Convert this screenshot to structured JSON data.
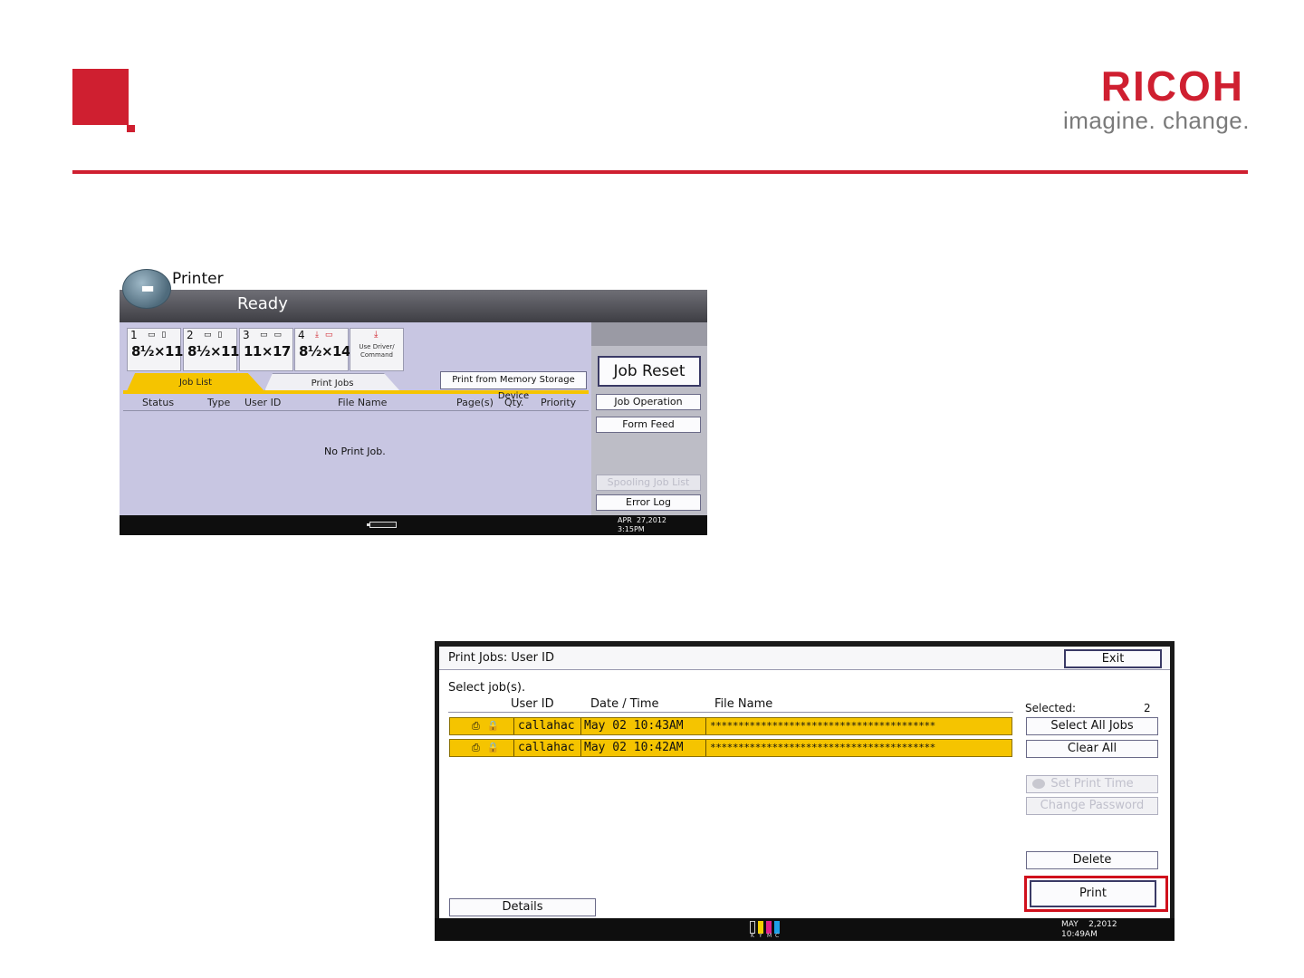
{
  "slide": {
    "logo_word": "RICOH",
    "logo_tagline": "imagine. change.",
    "accent": "#cf1f30"
  },
  "printer_screen": {
    "title": "Printer",
    "status": "Ready",
    "trays": [
      {
        "num": "1",
        "size": "8½×11"
      },
      {
        "num": "2",
        "size": "8½×11"
      },
      {
        "num": "3",
        "size": "11×17"
      },
      {
        "num": "4",
        "size": "8½×14"
      }
    ],
    "driver_line1": "Use Driver/",
    "driver_line2": "Command",
    "tabs": {
      "job_list": "Job List",
      "print_jobs": "Print Jobs"
    },
    "memory_button": "Print from Memory Storage Device",
    "columns": {
      "status": "Status",
      "type": "Type",
      "user_id": "User ID",
      "file_name": "File Name",
      "pages": "Page(s)",
      "qty": "Qty.",
      "priority": "Priority"
    },
    "empty_text": "No Print Job.",
    "buttons": {
      "job_reset": "Job Reset",
      "job_operation": "Job Operation",
      "form_feed": "Form Feed",
      "spooling": "Spooling Job List",
      "error_log": "Error Log"
    },
    "date_line1": "APR  27,2012",
    "date_line2": "3:15PM"
  },
  "print_jobs_screen": {
    "title": "Print Jobs: User ID",
    "exit": "Exit",
    "select_prompt": "Select job(s).",
    "columns": {
      "user_id": "User ID",
      "date_time": "Date / Time",
      "file_name": "File Name"
    },
    "selected_label": "Selected:",
    "selected_count": "2",
    "jobs": [
      {
        "user": "callahac",
        "datetime": "May  02 10:43AM",
        "file": "****************************************"
      },
      {
        "user": "callahac",
        "datetime": "May  02 10:42AM",
        "file": "****************************************"
      }
    ],
    "buttons": {
      "select_all": "Select All Jobs",
      "clear_all": "Clear All",
      "set_print_time": "Set Print Time",
      "change_password": "Change Password",
      "delete": "Delete",
      "print": "Print",
      "details": "Details"
    },
    "toner_letters": [
      "K",
      "Y",
      "M",
      "C"
    ],
    "date_line1": "MAY    2,2012",
    "date_line2": "10:49AM"
  }
}
